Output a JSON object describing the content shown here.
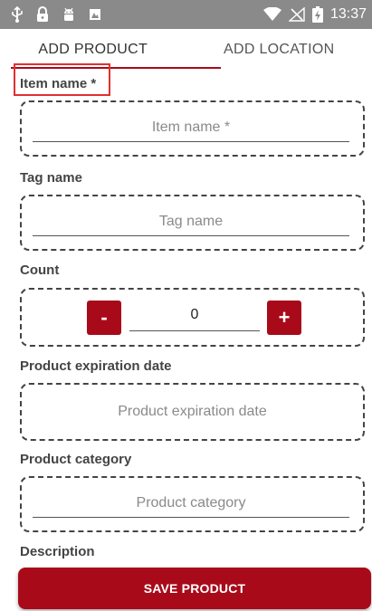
{
  "status_bar": {
    "time": "13:37",
    "left_icons": [
      "usb-icon",
      "lock-icon",
      "android-icon",
      "photo-icon"
    ],
    "right_icons": [
      "wifi-icon",
      "no-signal-icon",
      "battery-charging-icon"
    ]
  },
  "tabs": [
    {
      "label": "ADD PRODUCT",
      "active": true
    },
    {
      "label": "ADD LOCATION",
      "active": false
    }
  ],
  "form": {
    "item_name": {
      "label": "Item name *",
      "placeholder": "Item name *",
      "value": ""
    },
    "tag_name": {
      "label": "Tag name",
      "placeholder": "Tag name",
      "value": ""
    },
    "count": {
      "label": "Count",
      "value": "0",
      "minus_label": "-",
      "plus_label": "+"
    },
    "expiration_date": {
      "label": "Product expiration date",
      "placeholder": "Product expiration date"
    },
    "category": {
      "label": "Product category",
      "placeholder": "Product category",
      "value": ""
    },
    "description": {
      "label": "Description"
    }
  },
  "save_button": {
    "label": "SAVE PRODUCT"
  },
  "colors": {
    "accent": "#a80a1a",
    "status_bar": "#8a8a8a",
    "highlight": "#e03030"
  }
}
